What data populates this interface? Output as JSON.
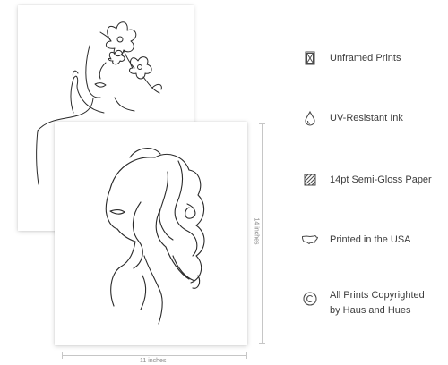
{
  "dimensions": {
    "height_label": "14 inches",
    "width_label": "11 inches"
  },
  "features": [
    {
      "icon": "unframed-print-icon",
      "label": "Unframed Prints"
    },
    {
      "icon": "ink-drop-icon",
      "label": "UV-Resistant Ink"
    },
    {
      "icon": "paper-texture-icon",
      "label": "14pt Semi-Gloss Paper"
    },
    {
      "icon": "usa-map-icon",
      "label": "Printed in the USA"
    },
    {
      "icon": "copyright-icon",
      "label_lines": [
        "All Prints Copyrighted",
        "by Haus and Hues"
      ]
    }
  ],
  "colors": {
    "line_art": "#2a2a2a",
    "text": "#3d3d3d",
    "dimension": "#c6c6c6"
  }
}
